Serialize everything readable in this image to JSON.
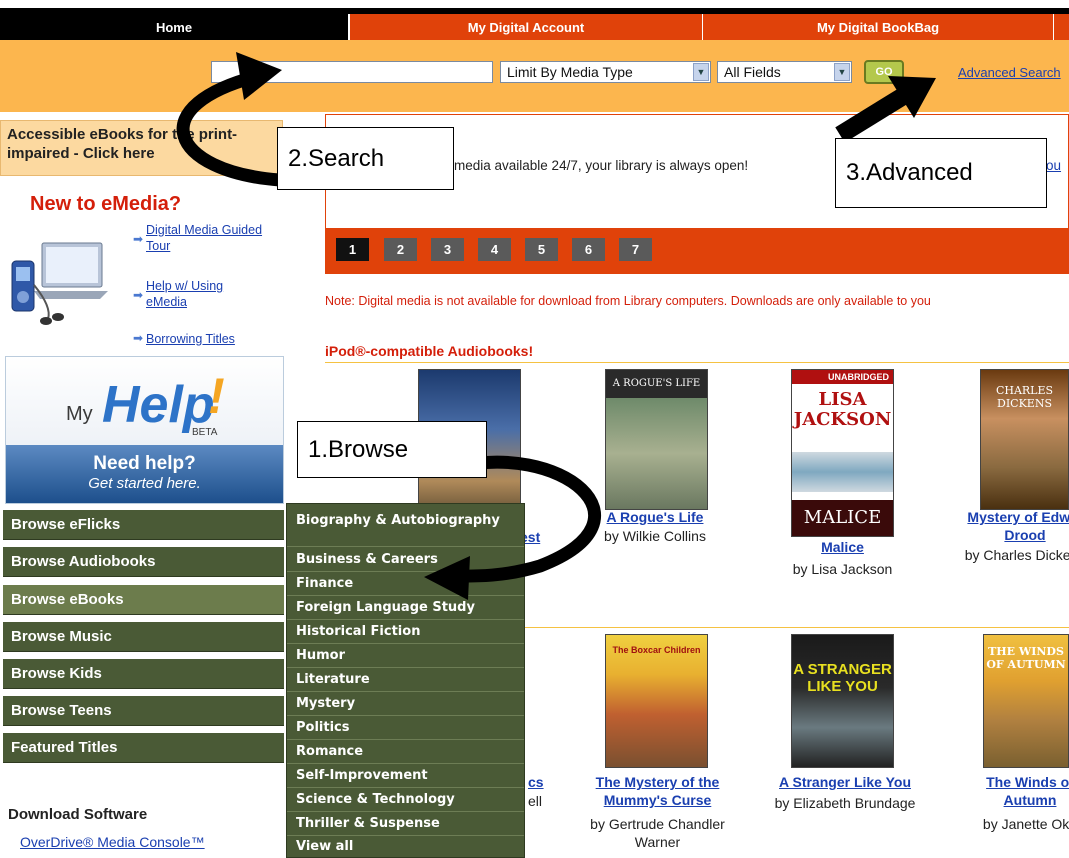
{
  "nav": {
    "home": "Home",
    "account": "My Digital Account",
    "bookbag": "My Digital BookBag"
  },
  "search": {
    "input_value": "",
    "media_type": "Limit By Media Type",
    "fields": "All Fields",
    "go_label": "GO",
    "advanced_label": "Advanced Search"
  },
  "sidebar": {
    "accessible_text": "Accessible eBooks for the print-impaired - Click here",
    "new_to_emedia": "New to eMedia?",
    "links": [
      "Digital Media Guided Tour",
      "Help w/ Using eMedia",
      "Borrowing Titles"
    ],
    "myhelp": {
      "my": "My",
      "help": "Help",
      "exclaim": "!",
      "beta": "BETA",
      "need": "Need help?",
      "started": "Get started here."
    },
    "browse": [
      "Browse eFlicks",
      "Browse Audiobooks",
      "Browse eBooks",
      "Browse Music",
      "Browse Kids",
      "Browse Teens",
      "Featured Titles"
    ],
    "download_title": "Download Software",
    "download_link": "OverDrive® Media Console™"
  },
  "banner": {
    "text": "media available 24/7, your library is always open!",
    "link": "ou",
    "pages": [
      "1",
      "2",
      "3",
      "4",
      "5",
      "6",
      "7"
    ],
    "current_page": 1
  },
  "note": "Note: Digital media is not available for download from Library computers. Downloads are only available to you",
  "section_title": "iPod®-compatible Audiobooks!",
  "books_row1": [
    {
      "title": "est",
      "author": ""
    },
    {
      "title": "A Rogue's Life",
      "author": "by Wilkie Collins"
    },
    {
      "title": "Malice",
      "author": "by Lisa Jackson"
    },
    {
      "title": "Mystery of Edwin Drood",
      "author": "by Charles Dickens"
    }
  ],
  "books_row2": [
    {
      "title": "cs",
      "author": "ell"
    },
    {
      "title": "The Mystery of the Mummy's Curse",
      "author": "by Gertrude Chandler Warner"
    },
    {
      "title": "A Stranger Like You",
      "author": "by Elizabeth Brundage"
    },
    {
      "title": "The Winds of Autumn",
      "author": "by Janette Oke"
    }
  ],
  "covers": {
    "rogue": "A ROGUE'S LIFE",
    "malice_pub": "UNABRIDGED",
    "malice_author": "LISA JACKSON",
    "malice_title": "MALICE",
    "drood": "CHARLES DICKENS",
    "boxcar": "The Boxcar Children",
    "stranger": "A STRANGER LIKE YOU",
    "winds": "THE WINDS OF AUTUMN"
  },
  "menu": [
    "Biography & Autobiography",
    "Business & Careers",
    "Finance",
    "Foreign Language Study",
    "Historical Fiction",
    "Humor",
    "Literature",
    "Mystery",
    "Politics",
    "Romance",
    "Self-Improvement",
    "Science & Technology",
    "Thriller & Suspense",
    "View all"
  ],
  "annotations": {
    "browse": "1.Browse",
    "search": "2.Search",
    "advanced": "3.Advanced"
  }
}
